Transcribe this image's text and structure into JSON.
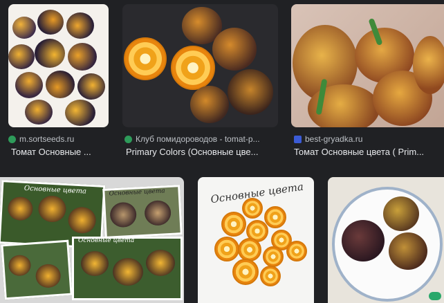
{
  "results": [
    {
      "source": "m.sortseeds.ru",
      "title": "Томат Основные ...",
      "fav_color": "#2e9b5a"
    },
    {
      "source": "Клуб помидороводов - tomat-p...",
      "title": "Primary Colors (Основные цве...",
      "fav_color": "#2e9b5a"
    },
    {
      "source": "best-gryadka.ru",
      "title": "Томат Основные цвета ( Prim...",
      "fav_color": "#3b5bd6"
    },
    {
      "image_text": "Основные цвета"
    },
    {
      "image_text": "Основные цвета"
    },
    {
      "image_text": ""
    }
  ]
}
